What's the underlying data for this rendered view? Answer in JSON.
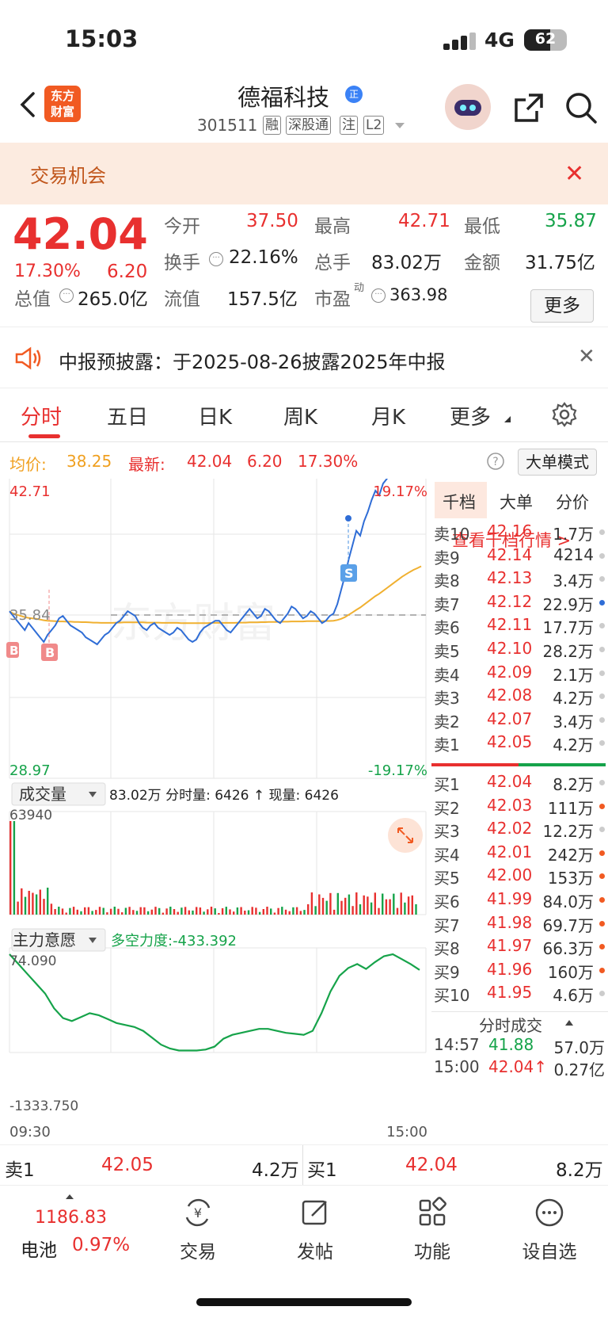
{
  "status": {
    "time": "15:03",
    "network": "4G",
    "battery": "62",
    "battery_level": 0.62
  },
  "header": {
    "logo": "东方财富",
    "stock_name": "德福科技",
    "badge": "正",
    "code": "301511",
    "tags": [
      "融",
      "深股通",
      "注",
      "L2"
    ]
  },
  "banner": {
    "text": "交易机会"
  },
  "quote": {
    "price": "42.04",
    "change_pct": "17.30%",
    "change": "6.20",
    "open_label": "今开",
    "open": "37.50",
    "high_label": "最高",
    "high": "42.71",
    "low_label": "最低",
    "low": "35.87",
    "turnover_label": "换手",
    "turnover": "22.16%",
    "volume_label": "总手",
    "volume": "83.02万",
    "amount_label": "金额",
    "amount": "31.75亿",
    "mktcap_label": "总值",
    "mktcap": "265.0亿",
    "float_label": "流值",
    "float": "157.5亿",
    "pe_label": "市盈",
    "pe_sup": "动",
    "pe": "363.98",
    "more": "更多"
  },
  "notice": {
    "text": "中报预披露：于2025-08-26披露2025年中报"
  },
  "tabs": [
    "分时",
    "五日",
    "日K",
    "周K",
    "月K",
    "更多"
  ],
  "info_line": {
    "avg_label": "均价:",
    "avg": "38.25",
    "last_label": "最新:",
    "last": "42.04",
    "change": "6.20",
    "pct": "17.30%",
    "big_order": "大单模式"
  },
  "chart_data": {
    "type": "line",
    "series": [],
    "ylim": [
      28.97,
      42.71
    ],
    "y_top": "42.71",
    "y_top_pct": "19.17%",
    "y_bottom": "28.97",
    "y_bottom_pct": "-19.17%",
    "prev_close": "35.84",
    "watermark": "东方财富",
    "markers": [
      "B",
      "B",
      "S"
    ],
    "price": [
      36.1,
      35.9,
      35.7,
      35.5,
      35.3,
      35.6,
      35.4,
      35.2,
      35.0,
      34.8,
      35.1,
      35.3,
      35.5,
      35.8,
      35.9,
      35.7,
      35.5,
      35.4,
      35.3,
      35.2,
      35.0,
      34.9,
      34.8,
      34.7,
      34.9,
      35.1,
      35.2,
      35.4,
      35.6,
      35.7,
      35.9,
      36.1,
      36.0,
      35.9,
      35.6,
      35.4,
      35.3,
      35.5,
      35.6,
      35.4,
      35.3,
      35.2,
      35.1,
      35.2,
      35.4,
      35.3,
      35.1,
      34.9,
      34.8,
      34.9,
      35.2,
      35.4,
      35.5,
      35.6,
      35.7,
      35.7,
      35.5,
      35.3,
      35.2,
      35.4,
      35.6,
      35.8,
      36.0,
      36.2,
      36.0,
      35.8,
      35.9,
      36.2,
      36.1,
      35.9,
      35.7,
      35.6,
      35.8,
      36.0,
      36.3,
      36.2,
      36.0,
      35.8,
      35.9,
      36.1,
      36.0,
      35.8,
      35.6,
      35.7,
      35.9,
      36.0,
      36.4,
      37.0,
      37.6,
      38.3,
      38.9,
      39.5,
      39.3,
      39.9,
      40.3,
      40.8,
      41.2,
      41.0,
      41.5,
      41.7,
      42.2,
      42.4,
      42.6,
      42.71,
      42.5,
      42.3,
      42.4,
      42.3,
      42.4
    ],
    "avg": [
      36.1,
      36.0,
      35.95,
      35.9,
      35.85,
      35.82,
      35.8,
      35.78,
      35.75,
      35.72,
      35.7,
      35.69,
      35.68,
      35.67,
      35.67,
      35.66,
      35.66,
      35.65,
      35.65,
      35.64,
      35.64,
      35.63,
      35.62,
      35.62,
      35.61,
      35.61,
      35.61,
      35.61,
      35.62,
      35.62,
      35.63,
      35.63,
      35.63,
      35.63,
      35.63,
      35.63,
      35.62,
      35.62,
      35.62,
      35.62,
      35.61,
      35.61,
      35.61,
      35.61,
      35.61,
      35.6,
      35.6,
      35.6,
      35.6,
      35.6,
      35.6,
      35.6,
      35.6,
      35.61,
      35.61,
      35.61,
      35.61,
      35.61,
      35.61,
      35.61,
      35.62,
      35.62,
      35.62,
      35.63,
      35.63,
      35.63,
      35.64,
      35.64,
      35.65,
      35.65,
      35.65,
      35.65,
      35.66,
      35.66,
      35.67,
      35.67,
      35.67,
      35.67,
      35.68,
      35.68,
      35.68,
      35.68,
      35.68,
      35.69,
      35.69,
      35.7,
      35.73,
      35.78,
      35.85,
      35.95,
      36.05,
      36.16,
      36.26,
      36.38,
      36.5,
      36.62,
      36.74,
      36.84,
      36.96,
      37.08,
      37.2,
      37.32,
      37.44,
      37.56,
      37.66,
      37.76,
      37.85,
      37.92,
      38.0
    ],
    "volume_label": "成交量",
    "volume_text": "83.02万 分时量: 6426 ↑ 现量: 6426",
    "volume_max": "63940",
    "indicator_label": "主力意愿",
    "indicator_text": "多空力度:-433.392",
    "indicator_top": "74.090",
    "indicator_bottom": "-1333.750",
    "time_start": "09:30",
    "time_end": "15:00"
  },
  "orderbook": {
    "tabs": [
      "千档",
      "大单",
      "分价"
    ],
    "link": "查看千档行情 >",
    "asks": [
      {
        "label": "卖10",
        "price": "42.16",
        "vol": "1.7万"
      },
      {
        "label": "卖9",
        "price": "42.14",
        "vol": "4214"
      },
      {
        "label": "卖8",
        "price": "42.13",
        "vol": "3.4万"
      },
      {
        "label": "卖7",
        "price": "42.12",
        "vol": "22.9万"
      },
      {
        "label": "卖6",
        "price": "42.11",
        "vol": "17.7万"
      },
      {
        "label": "卖5",
        "price": "42.10",
        "vol": "28.2万"
      },
      {
        "label": "卖4",
        "price": "42.09",
        "vol": "2.1万"
      },
      {
        "label": "卖3",
        "price": "42.08",
        "vol": "4.2万"
      },
      {
        "label": "卖2",
        "price": "42.07",
        "vol": "3.4万"
      },
      {
        "label": "卖1",
        "price": "42.05",
        "vol": "4.2万"
      }
    ],
    "bids": [
      {
        "label": "买1",
        "price": "42.04",
        "vol": "8.2万"
      },
      {
        "label": "买2",
        "price": "42.03",
        "vol": "111万"
      },
      {
        "label": "买3",
        "price": "42.02",
        "vol": "12.2万"
      },
      {
        "label": "买4",
        "price": "42.01",
        "vol": "242万"
      },
      {
        "label": "买5",
        "price": "42.00",
        "vol": "153万"
      },
      {
        "label": "买6",
        "price": "41.99",
        "vol": "84.0万"
      },
      {
        "label": "买7",
        "price": "41.98",
        "vol": "69.7万"
      },
      {
        "label": "买8",
        "price": "41.97",
        "vol": "66.3万"
      },
      {
        "label": "买9",
        "price": "41.96",
        "vol": "160万"
      },
      {
        "label": "买10",
        "price": "41.95",
        "vol": "4.6万"
      }
    ],
    "ticks_title": "分时成交",
    "ticks": [
      {
        "time": "14:57",
        "price": "41.88",
        "vol": "57.0万"
      },
      {
        "time": "15:00",
        "price": "42.04↑",
        "vol": "0.27亿"
      }
    ]
  },
  "bottom_quote": {
    "sell_label": "卖1",
    "sell_price": "42.05",
    "sell_vol": "4.2万",
    "buy_label": "买1",
    "buy_price": "42.04",
    "buy_vol": "8.2万"
  },
  "nav": {
    "index_value": "1186.83",
    "index_name": "电池",
    "index_pct": "0.97%",
    "items": [
      "交易",
      "发帖",
      "功能",
      "设自选"
    ]
  }
}
